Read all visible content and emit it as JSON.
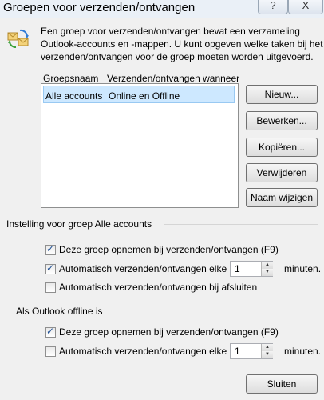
{
  "window": {
    "title": "Groepen voor verzenden/ontvangen",
    "help_label": "?",
    "close_label": "X"
  },
  "description": [
    "Een groep voor verzenden/ontvangen bevat een verzameling",
    "Outlook-accounts en -mappen. U kunt opgeven welke taken bij het",
    "verzenden/ontvangen voor de groep moeten worden uitgevoerd."
  ],
  "list": {
    "col_name": "Groepsnaam",
    "col_when": "Verzenden/ontvangen wanneer",
    "rows": [
      {
        "name": "Alle accounts",
        "when": "Online en Offline",
        "selected": true
      }
    ]
  },
  "buttons": {
    "new": "Nieuw...",
    "edit": "Bewerken...",
    "copy": "Kopiëren...",
    "delete": "Verwijderen",
    "rename": "Naam wijzigen",
    "close": "Sluiten"
  },
  "settings_section": {
    "title": "Instelling voor groep Alle accounts",
    "include_label": "Deze groep opnemen bij verzenden/ontvangen (F9)",
    "include_checked": true,
    "auto_label": "Automatisch verzenden/ontvangen elke",
    "auto_checked": true,
    "auto_minutes": "1",
    "minutes_label": "minuten.",
    "exit_label": "Automatisch verzenden/ontvangen bij afsluiten",
    "exit_checked": false
  },
  "offline_section": {
    "title": "Als Outlook offline is",
    "include_label": "Deze groep opnemen bij verzenden/ontvangen (F9)",
    "include_checked": true,
    "auto_label": "Automatisch verzenden/ontvangen elke",
    "auto_checked": false,
    "auto_minutes": "1",
    "minutes_label": "minuten."
  },
  "icons": {
    "dialog_icon": "send-receive-icon",
    "check_mark": "✓",
    "spin_up": "▲",
    "spin_down": "▼"
  }
}
